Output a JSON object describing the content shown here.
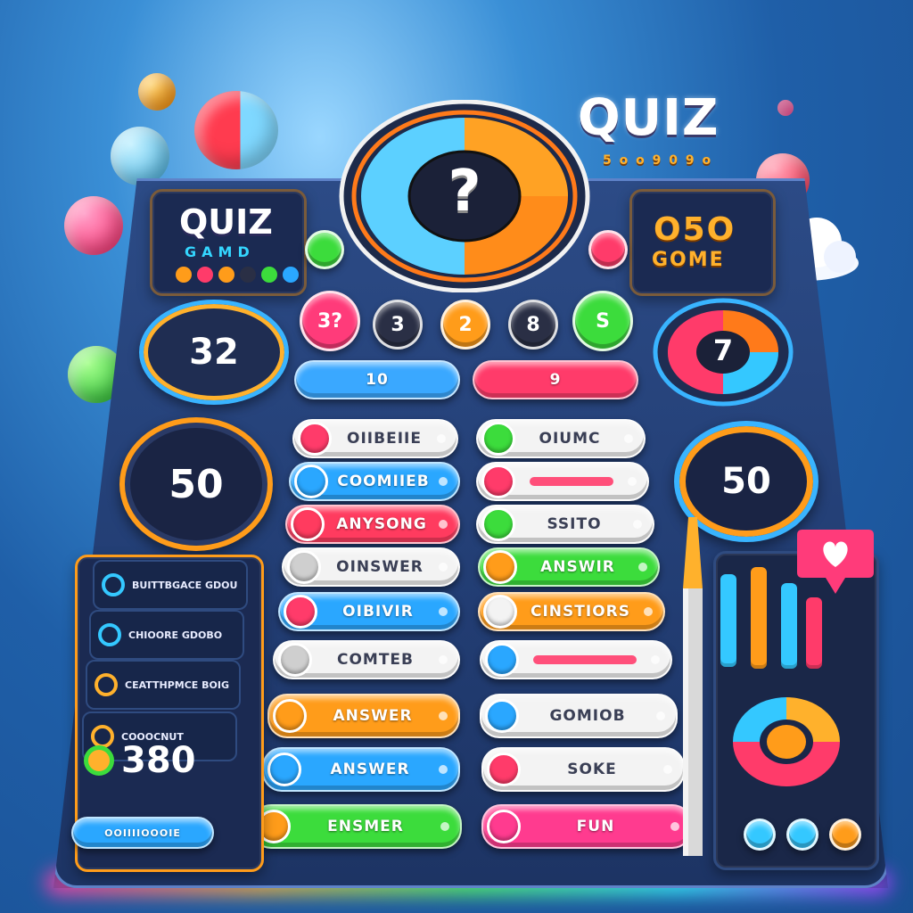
{
  "header": {
    "quiz_title": "QUIZ",
    "quiz_subtitle": "5 ο ο 9 0 9 ο"
  },
  "center_wheel": {
    "symbol": "?"
  },
  "top_left_panel": {
    "title": "QUIZ",
    "subtitle": "GAMD"
  },
  "top_right_panel": {
    "line1": "O5O",
    "line2": "GOME"
  },
  "left_scores": {
    "score_a": "32",
    "score_b": "50"
  },
  "right_scores": {
    "score_a": "7",
    "score_b": "50"
  },
  "number_buttons": [
    {
      "label": "3?",
      "color": "#ff3b7a"
    },
    {
      "label": "3",
      "color": "#2a2f45"
    },
    {
      "label": "2",
      "color": "#ff9c1a"
    },
    {
      "label": "8",
      "color": "#2a2f45"
    },
    {
      "label": "S",
      "color": "#3cdc3c"
    }
  ],
  "top_pills": [
    {
      "label": "10",
      "color": "#3aa8ff"
    },
    {
      "label": "9",
      "color": "#ff3b6a"
    }
  ],
  "answer_left": [
    {
      "label": "OIIBEIIE",
      "color": "#f3f3f3",
      "knob": "#ff3b6a",
      "light": true
    },
    {
      "label": "COOMIIEB",
      "color": "#2aa7ff",
      "knob": "#2aa7ff",
      "light": false
    },
    {
      "label": "ANYSONG",
      "color": "#ff3b5f",
      "knob": "#ff3b5f",
      "light": false
    },
    {
      "label": "OINSWER",
      "color": "#f3f3f3",
      "knob": "#cfcfcf",
      "light": true
    },
    {
      "label": "OIBIVIR",
      "color": "#2aa7ff",
      "knob": "#ff3b6a",
      "light": false
    },
    {
      "label": "COMTEB",
      "color": "#f3f3f3",
      "knob": "#cfcfcf",
      "light": true
    },
    {
      "label": "ANSWER",
      "color": "#ff9c1a",
      "knob": "#ff9c1a",
      "light": false
    },
    {
      "label": "ANSWER",
      "color": "#2aa7ff",
      "knob": "#2aa7ff",
      "light": false
    },
    {
      "label": "ENSMER",
      "color": "#3cdc3c",
      "knob": "#ff9c1a",
      "light": false
    }
  ],
  "answer_right": [
    {
      "label": "OIUMC",
      "color": "#f3f3f3",
      "knob": "#3cdc3c",
      "light": true
    },
    {
      "label": "",
      "color": "#f3f3f3",
      "knob": "#ff3b6a",
      "light": true
    },
    {
      "label": "SSITO",
      "color": "#f3f3f3",
      "knob": "#3cdc3c",
      "light": true
    },
    {
      "label": "ANSWIR",
      "color": "#3cdc3c",
      "knob": "#ff9c1a",
      "light": false
    },
    {
      "label": "CINSTIORS",
      "color": "#ff9c1a",
      "knob": "#f3f3f3",
      "light": false
    },
    {
      "label": "",
      "color": "#f3f3f3",
      "knob": "#2aa7ff",
      "light": true
    },
    {
      "label": "GOMIOB",
      "color": "#f3f3f3",
      "knob": "#2aa7ff",
      "light": true
    },
    {
      "label": "SOKE",
      "color": "#f3f3f3",
      "knob": "#ff3b6a",
      "light": true
    },
    {
      "label": "FUN",
      "color": "#ff3b8f",
      "knob": "#ff3b8f",
      "light": false
    }
  ],
  "side_list": [
    {
      "text": "BUITTBGACE GDOU"
    },
    {
      "text": "CHIOORE GDOBO"
    },
    {
      "text": "CEATTHPMCE BOIG"
    },
    {
      "text": "COOOCNUT"
    }
  ],
  "side_score": "380",
  "side_bottom_label": "OOIIIIOOOIE",
  "colors": {
    "board": "#223d73",
    "panel": "#1b2a52",
    "accent_gold": "#ffb12c",
    "accent_pink": "#ff3b6a",
    "accent_blue": "#2aa7ff",
    "accent_green": "#3cdc3c"
  },
  "icons": [
    "heart-icon",
    "cloud-icon",
    "pencil-icon",
    "donut-chart-icon",
    "bar-chart-icon"
  ]
}
